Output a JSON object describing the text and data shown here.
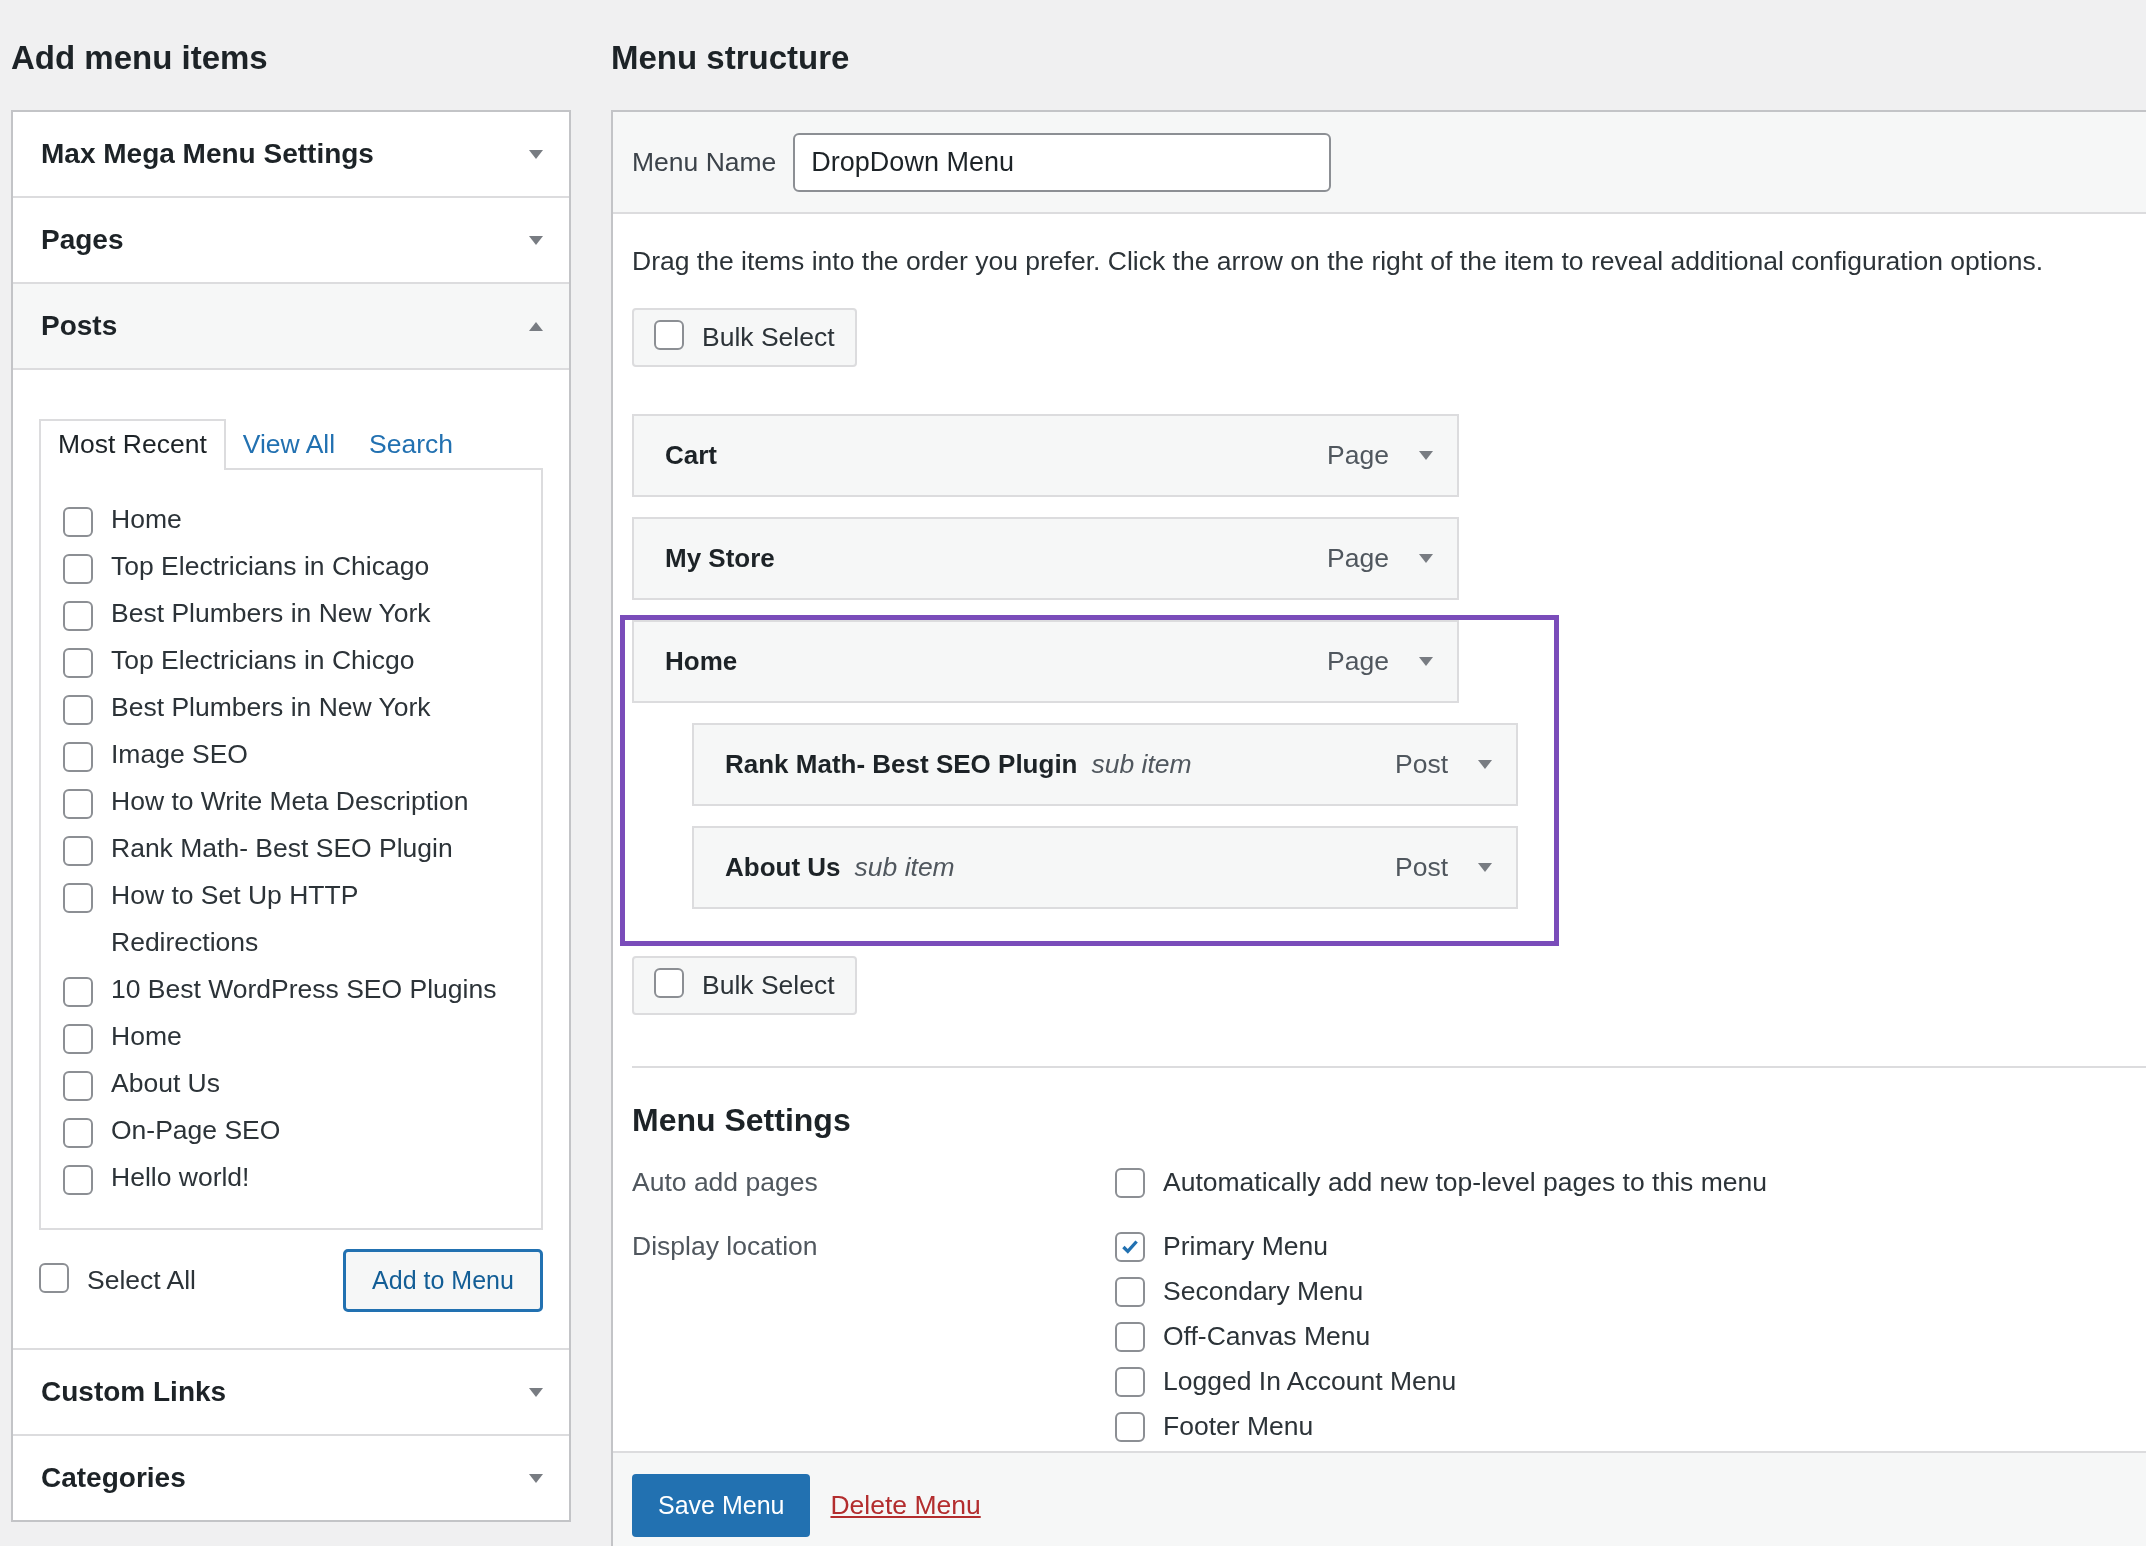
{
  "add_items": {
    "title": "Add menu items",
    "sections": [
      {
        "title": "Max Mega Menu Settings",
        "expanded": false
      },
      {
        "title": "Pages",
        "expanded": false
      },
      {
        "title": "Posts",
        "expanded": true,
        "tabs": [
          {
            "label": "Most Recent",
            "selected": true
          },
          {
            "label": "View All",
            "selected": false
          },
          {
            "label": "Search",
            "selected": false
          }
        ],
        "items": [
          {
            "label": "Home",
            "checked": false
          },
          {
            "label": "Top Electricians in Chicago",
            "checked": false
          },
          {
            "label": "Best Plumbers in New York",
            "checked": false
          },
          {
            "label": "Top Electricians in Chicgo",
            "checked": false
          },
          {
            "label": "Best Plumbers in New York",
            "checked": false
          },
          {
            "label": "Image SEO",
            "checked": false
          },
          {
            "label": "How to Write Meta Description",
            "checked": false
          },
          {
            "label": "Rank Math- Best SEO Plugin",
            "checked": false
          },
          {
            "label": "How to Set Up HTTP Redirections",
            "checked": false
          },
          {
            "label": "10 Best WordPress SEO Plugins",
            "checked": false
          },
          {
            "label": "Home",
            "checked": false
          },
          {
            "label": "About Us",
            "checked": false
          },
          {
            "label": "On-Page SEO",
            "checked": false
          },
          {
            "label": "Hello world!",
            "checked": false
          }
        ],
        "select_all": {
          "label": "Select All",
          "checked": false
        },
        "add_button": "Add to Menu"
      },
      {
        "title": "Custom Links",
        "expanded": false
      },
      {
        "title": "Categories",
        "expanded": false
      }
    ]
  },
  "menu_structure": {
    "title": "Menu structure",
    "menu_name": {
      "label": "Menu Name",
      "value": "DropDown Menu"
    },
    "instructions": "Drag the items into the order you prefer. Click the arrow on the right of the item to reveal additional configuration options.",
    "bulk_select_top": {
      "label": "Bulk Select",
      "checked": false
    },
    "items": [
      {
        "title": "Cart",
        "type": "Page",
        "highlighted": false
      },
      {
        "title": "My Store",
        "type": "Page",
        "highlighted": false
      },
      {
        "title": "Home",
        "type": "Page",
        "highlighted": true,
        "children": [
          {
            "title": "Rank Math- Best SEO Plugin",
            "note": "sub item",
            "type": "Post"
          },
          {
            "title": "About Us",
            "note": "sub item",
            "type": "Post"
          }
        ]
      }
    ],
    "bulk_select_bottom": {
      "label": "Bulk Select",
      "checked": false
    },
    "settings": {
      "title": "Menu Settings",
      "rows": [
        {
          "label": "Auto add pages",
          "options": [
            {
              "label": "Automatically add new top-level pages to this menu",
              "checked": false
            }
          ]
        },
        {
          "label": "Display location",
          "options": [
            {
              "label": "Primary Menu",
              "checked": true
            },
            {
              "label": "Secondary Menu",
              "checked": false
            },
            {
              "label": "Off-Canvas Menu",
              "checked": false
            },
            {
              "label": "Logged In Account Menu",
              "checked": false
            },
            {
              "label": "Footer Menu",
              "checked": false
            }
          ]
        }
      ]
    },
    "footer": {
      "save_button": "Save Menu",
      "delete_link": "Delete Menu"
    }
  }
}
